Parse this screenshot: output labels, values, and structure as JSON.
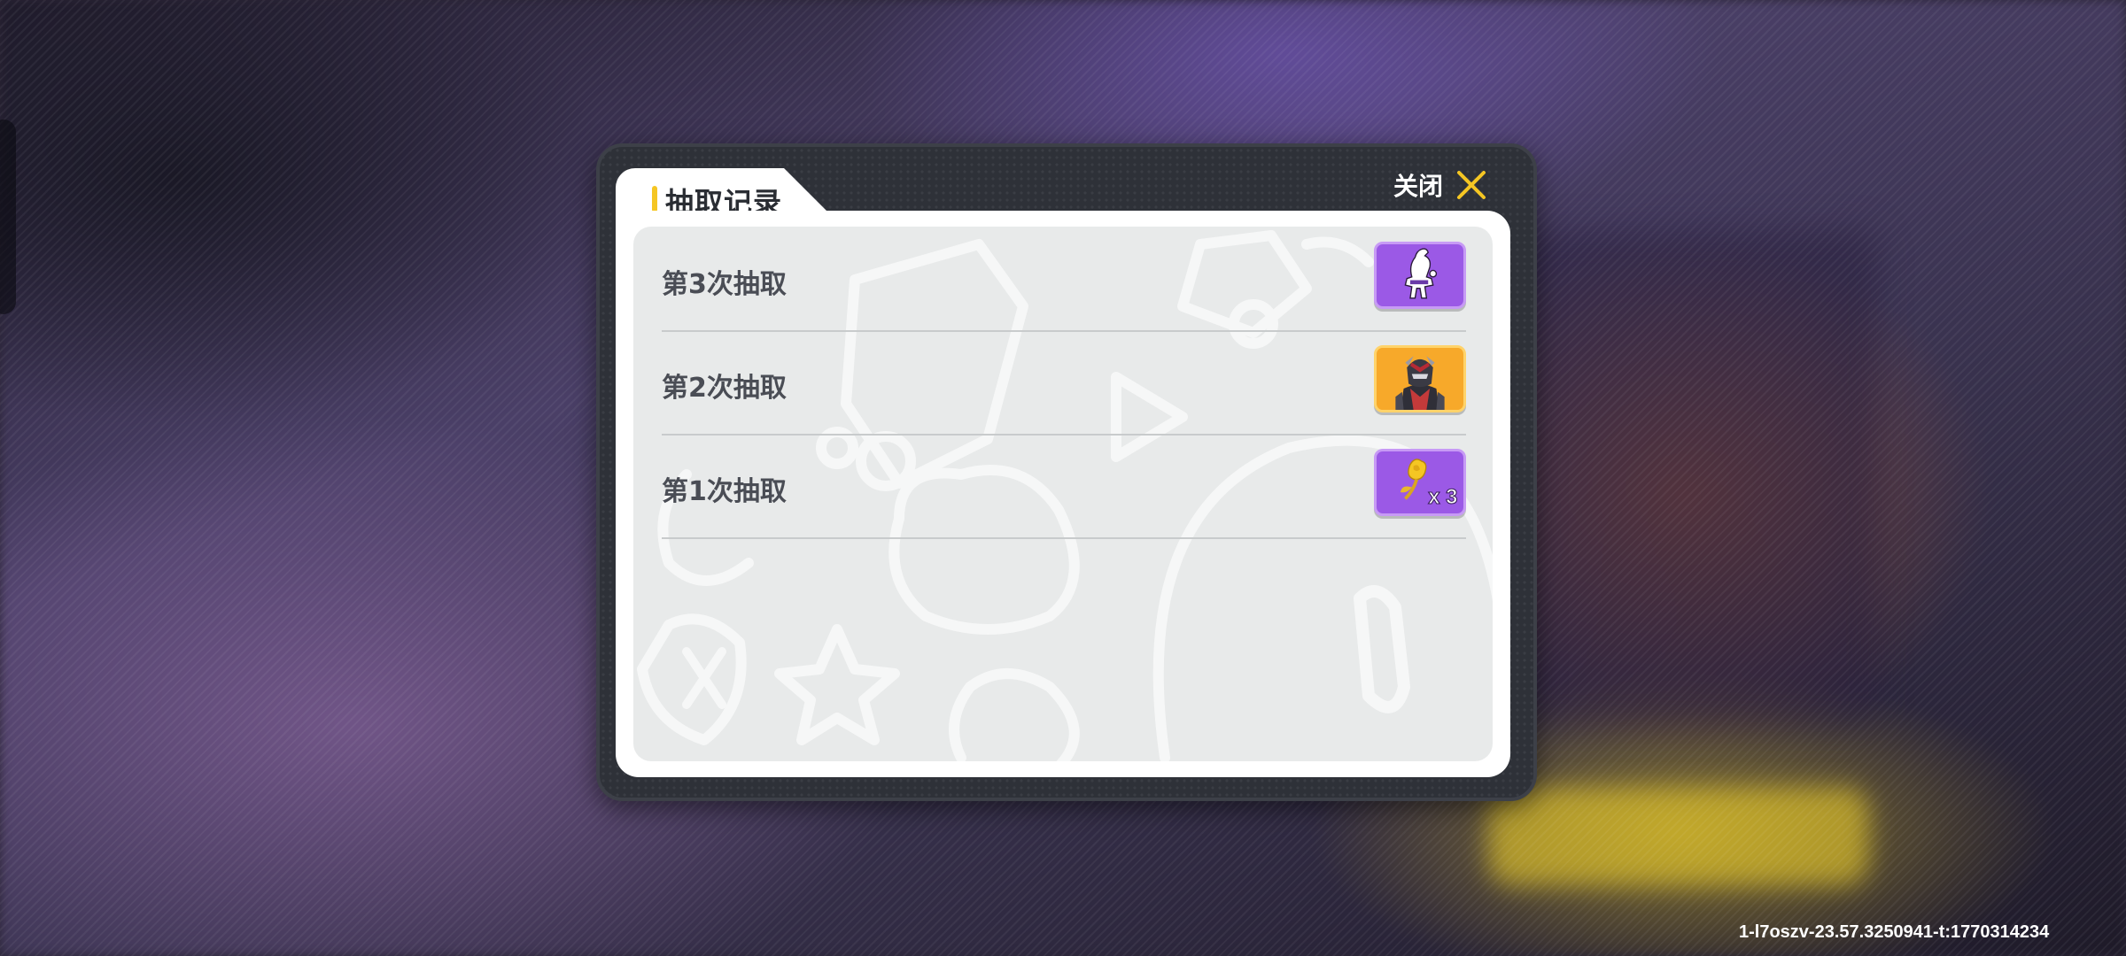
{
  "dialog": {
    "title": "抽取记录",
    "close_label": "关闭"
  },
  "records": [
    {
      "label": "第3次抽取",
      "reward_icon": "character-silhouette-icon",
      "reward_quantity": "",
      "tier_color": "#9b59e6"
    },
    {
      "label": "第2次抽取",
      "reward_icon": "armored-hero-portrait",
      "reward_quantity": "",
      "tier_color": "#f7a92a"
    },
    {
      "label": "第1次抽取",
      "reward_icon": "gold-rose-icon",
      "reward_quantity": "x 3",
      "tier_color": "#9b59e6"
    }
  ],
  "footer": {
    "version": "1-l7oszv-23.57.3250941-t:1770314234"
  },
  "colors": {
    "accent": "#f5c623",
    "dialog_frame": "#2e3138",
    "purple_tier": "#9b59e6",
    "orange_tier": "#f7a92a"
  }
}
